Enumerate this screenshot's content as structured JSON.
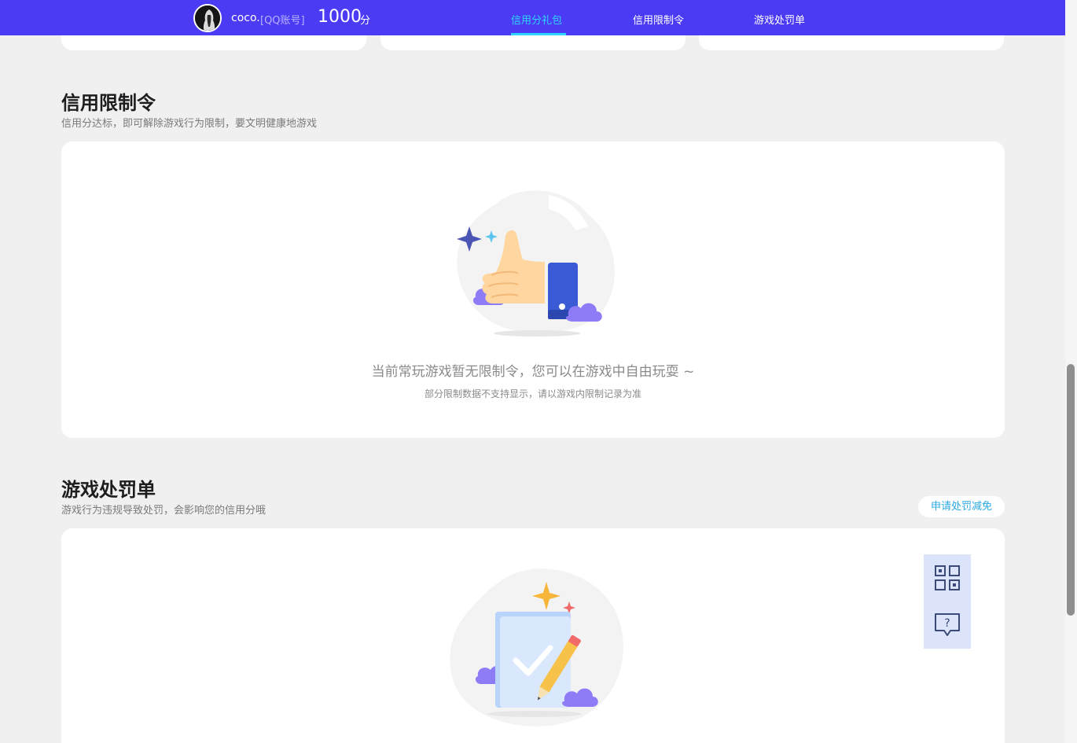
{
  "header": {
    "username": "coco.",
    "account_type": "[QQ账号]",
    "score": "1000",
    "score_unit": "分",
    "tabs": [
      {
        "label": "信用分礼包",
        "active": true
      },
      {
        "label": "信用限制令",
        "active": false
      },
      {
        "label": "游戏处罚单",
        "active": false
      }
    ]
  },
  "restriction": {
    "title": "信用限制令",
    "subtitle": "信用分达标，即可解除游戏行为限制，要文明健康地游戏",
    "empty_text": "当前常玩游戏暂无限制令，您可以在游戏中自由玩耍 ~",
    "empty_note": "部分限制数据不支持显示，请以游戏内限制记录为准"
  },
  "penalty": {
    "title": "游戏处罚单",
    "subtitle": "游戏行为违规导致处罚，会影响您的信用分哦",
    "apply_label": "申请处罚减免"
  },
  "float_buttons": [
    {
      "icon": "qrcode-icon"
    },
    {
      "icon": "help-chat-icon"
    }
  ],
  "colors": {
    "header_bg": "#4b3bf5",
    "active_tab": "#2fd5ff",
    "link": "#2aa8e0",
    "page_bg": "#f0f0f0"
  }
}
